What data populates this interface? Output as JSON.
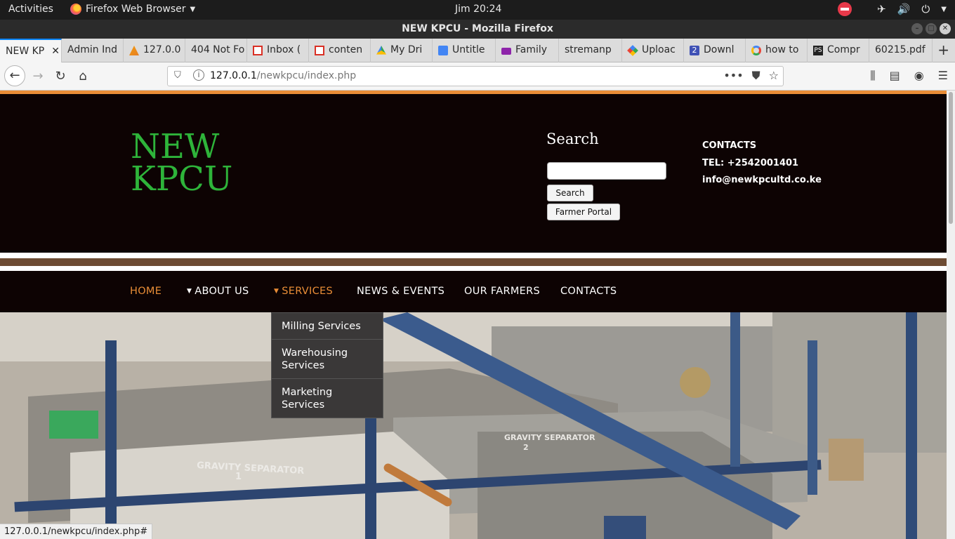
{
  "system_bar": {
    "activities": "Activities",
    "app_name": "Firefox Web Browser",
    "clock": "Jim 20:24"
  },
  "window": {
    "title": "NEW KPCU - Mozilla Firefox"
  },
  "tabs": [
    {
      "label": "NEW KP",
      "icon": "none",
      "active": true
    },
    {
      "label": "Admin Ind",
      "icon": "none"
    },
    {
      "label": "127.0.0",
      "icon": "pma-icon"
    },
    {
      "label": "404 Not Fo",
      "icon": "none"
    },
    {
      "label": "Inbox (",
      "icon": "gmail-icon"
    },
    {
      "label": "conten",
      "icon": "gmail-icon"
    },
    {
      "label": "My Dri",
      "icon": "drive-icon"
    },
    {
      "label": "Untitle",
      "icon": "docs-icon"
    },
    {
      "label": "Family",
      "icon": "folder-icon"
    },
    {
      "label": "stremanp",
      "icon": "none"
    },
    {
      "label": "Uploac",
      "icon": "upload-icon"
    },
    {
      "label": "Downl",
      "icon": "download-icon"
    },
    {
      "label": "how to",
      "icon": "google-icon"
    },
    {
      "label": "Compr",
      "icon": "ps-icon"
    },
    {
      "label": "60215.pdf",
      "icon": "none"
    }
  ],
  "navbar": {
    "url_host": "127.0.0.1",
    "url_path": "/newkpcu/index.php"
  },
  "site": {
    "logo_line1": "NEW",
    "logo_line2": "KPCU",
    "search_title": "Search",
    "search_button": "Search",
    "portal_button": "Farmer Portal",
    "contacts_heading": "CONTACTS",
    "contacts_tel": "TEL: +2542001401",
    "contacts_email": "info@newkpcultd.co.ke",
    "menu": {
      "home": "HOME",
      "about": "ABOUT US",
      "services": "SERVICES",
      "news": "NEWS & EVENTS",
      "farmers": "OUR FARMERS",
      "contacts": "CONTACTS"
    },
    "services_dropdown": [
      "Milling Services",
      "Warehousing Services",
      "Marketing Services"
    ],
    "hero": {
      "label_1": "GRAVITY SEPARATOR",
      "label_1_num": "1",
      "label_2": "GRAVITY SEPARATOR",
      "label_2_num": "2"
    }
  },
  "status_bar": "127.0.0.1/newkpcu/index.php#",
  "colors": {
    "accent_orange": "#e98d37",
    "logo_green": "#2eb43a",
    "header_bg": "#0d0303",
    "brown_bar": "#6d4b33"
  }
}
